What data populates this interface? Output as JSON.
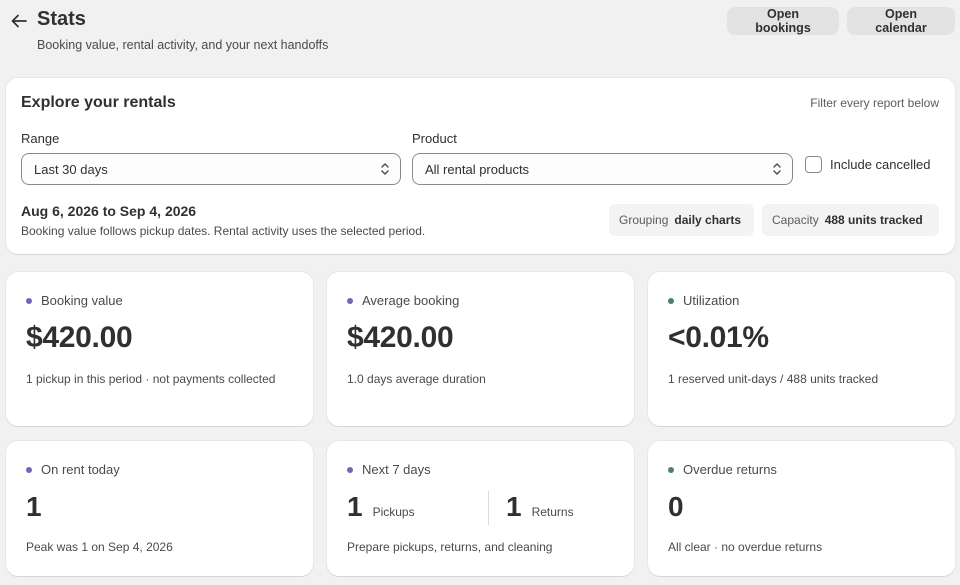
{
  "header": {
    "title": "Stats",
    "subtitle": "Booking value, rental activity, and your next handoffs",
    "open_bookings": "Open bookings",
    "open_calendar": "Open calendar"
  },
  "explore": {
    "title": "Explore your rentals",
    "hint": "Filter every report below",
    "range_label": "Range",
    "range_value": "Last 30 days",
    "product_label": "Product",
    "product_value": "All rental products",
    "include_cancelled": "Include cancelled",
    "include_cancelled_checked": false,
    "dates": "Aug 6, 2026 to Sep 4, 2026",
    "note": "Booking value follows pickup dates. Rental activity uses the selected period.",
    "grouping_key": "Grouping",
    "grouping_val": "daily charts",
    "capacity_key": "Capacity",
    "capacity_val": "488 units tracked"
  },
  "colors": {
    "purple_dot": "#6b6ab8",
    "green_dot": "#4f8060"
  },
  "stats": {
    "booking_value": {
      "label": "Booking value",
      "value": "$420.00",
      "note": "1 pickup in this period · not payments collected"
    },
    "average_booking": {
      "label": "Average booking",
      "value": "$420.00",
      "note": "1.0 days average duration"
    },
    "utilization": {
      "label": "Utilization",
      "value": "<0.01%",
      "note": "1 reserved unit-days / 488 units tracked"
    },
    "on_rent_today": {
      "label": "On rent today",
      "value": "1",
      "note": "Peak was 1 on Sep 4, 2026"
    },
    "next_7_days": {
      "label": "Next 7 days",
      "pickups_value": "1",
      "pickups_label": "Pickups",
      "returns_value": "1",
      "returns_label": "Returns",
      "note": "Prepare pickups, returns, and cleaning"
    },
    "overdue_returns": {
      "label": "Overdue returns",
      "value": "0",
      "note": "All clear · no overdue returns"
    }
  }
}
